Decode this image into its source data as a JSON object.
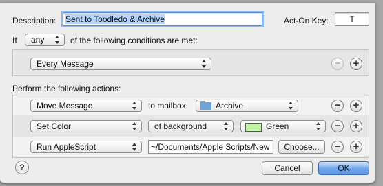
{
  "dialog": {
    "description_label": "Description:",
    "description_value": "Sent to Toodledo & Archive",
    "acton_key_label": "Act-On Key:",
    "acton_key_value": "T",
    "if_label": "If",
    "match_mode": "any",
    "conditions_suffix": "of the following conditions are met:",
    "actions_heading": "Perform the following actions:",
    "help_label": "?",
    "cancel_label": "Cancel",
    "ok_label": "OK"
  },
  "conditions": [
    {
      "criterion": "Every Message",
      "remove_label": "−",
      "add_label": "+"
    }
  ],
  "actions": [
    {
      "action": "Move Message",
      "middle_label": "to mailbox:",
      "mailbox": "Archive",
      "mailbox_icon": "folder-icon",
      "remove_label": "−",
      "add_label": "+"
    },
    {
      "action": "Set Color",
      "color_target": "of background",
      "color_name": "Green",
      "color_hex": "#c4f0a8",
      "remove_label": "−",
      "add_label": "+"
    },
    {
      "action": "Run AppleScript",
      "script_path": "~/Documents/Apple Scripts/New",
      "choose_label": "Choose...",
      "remove_label": "−",
      "add_label": "+"
    }
  ]
}
